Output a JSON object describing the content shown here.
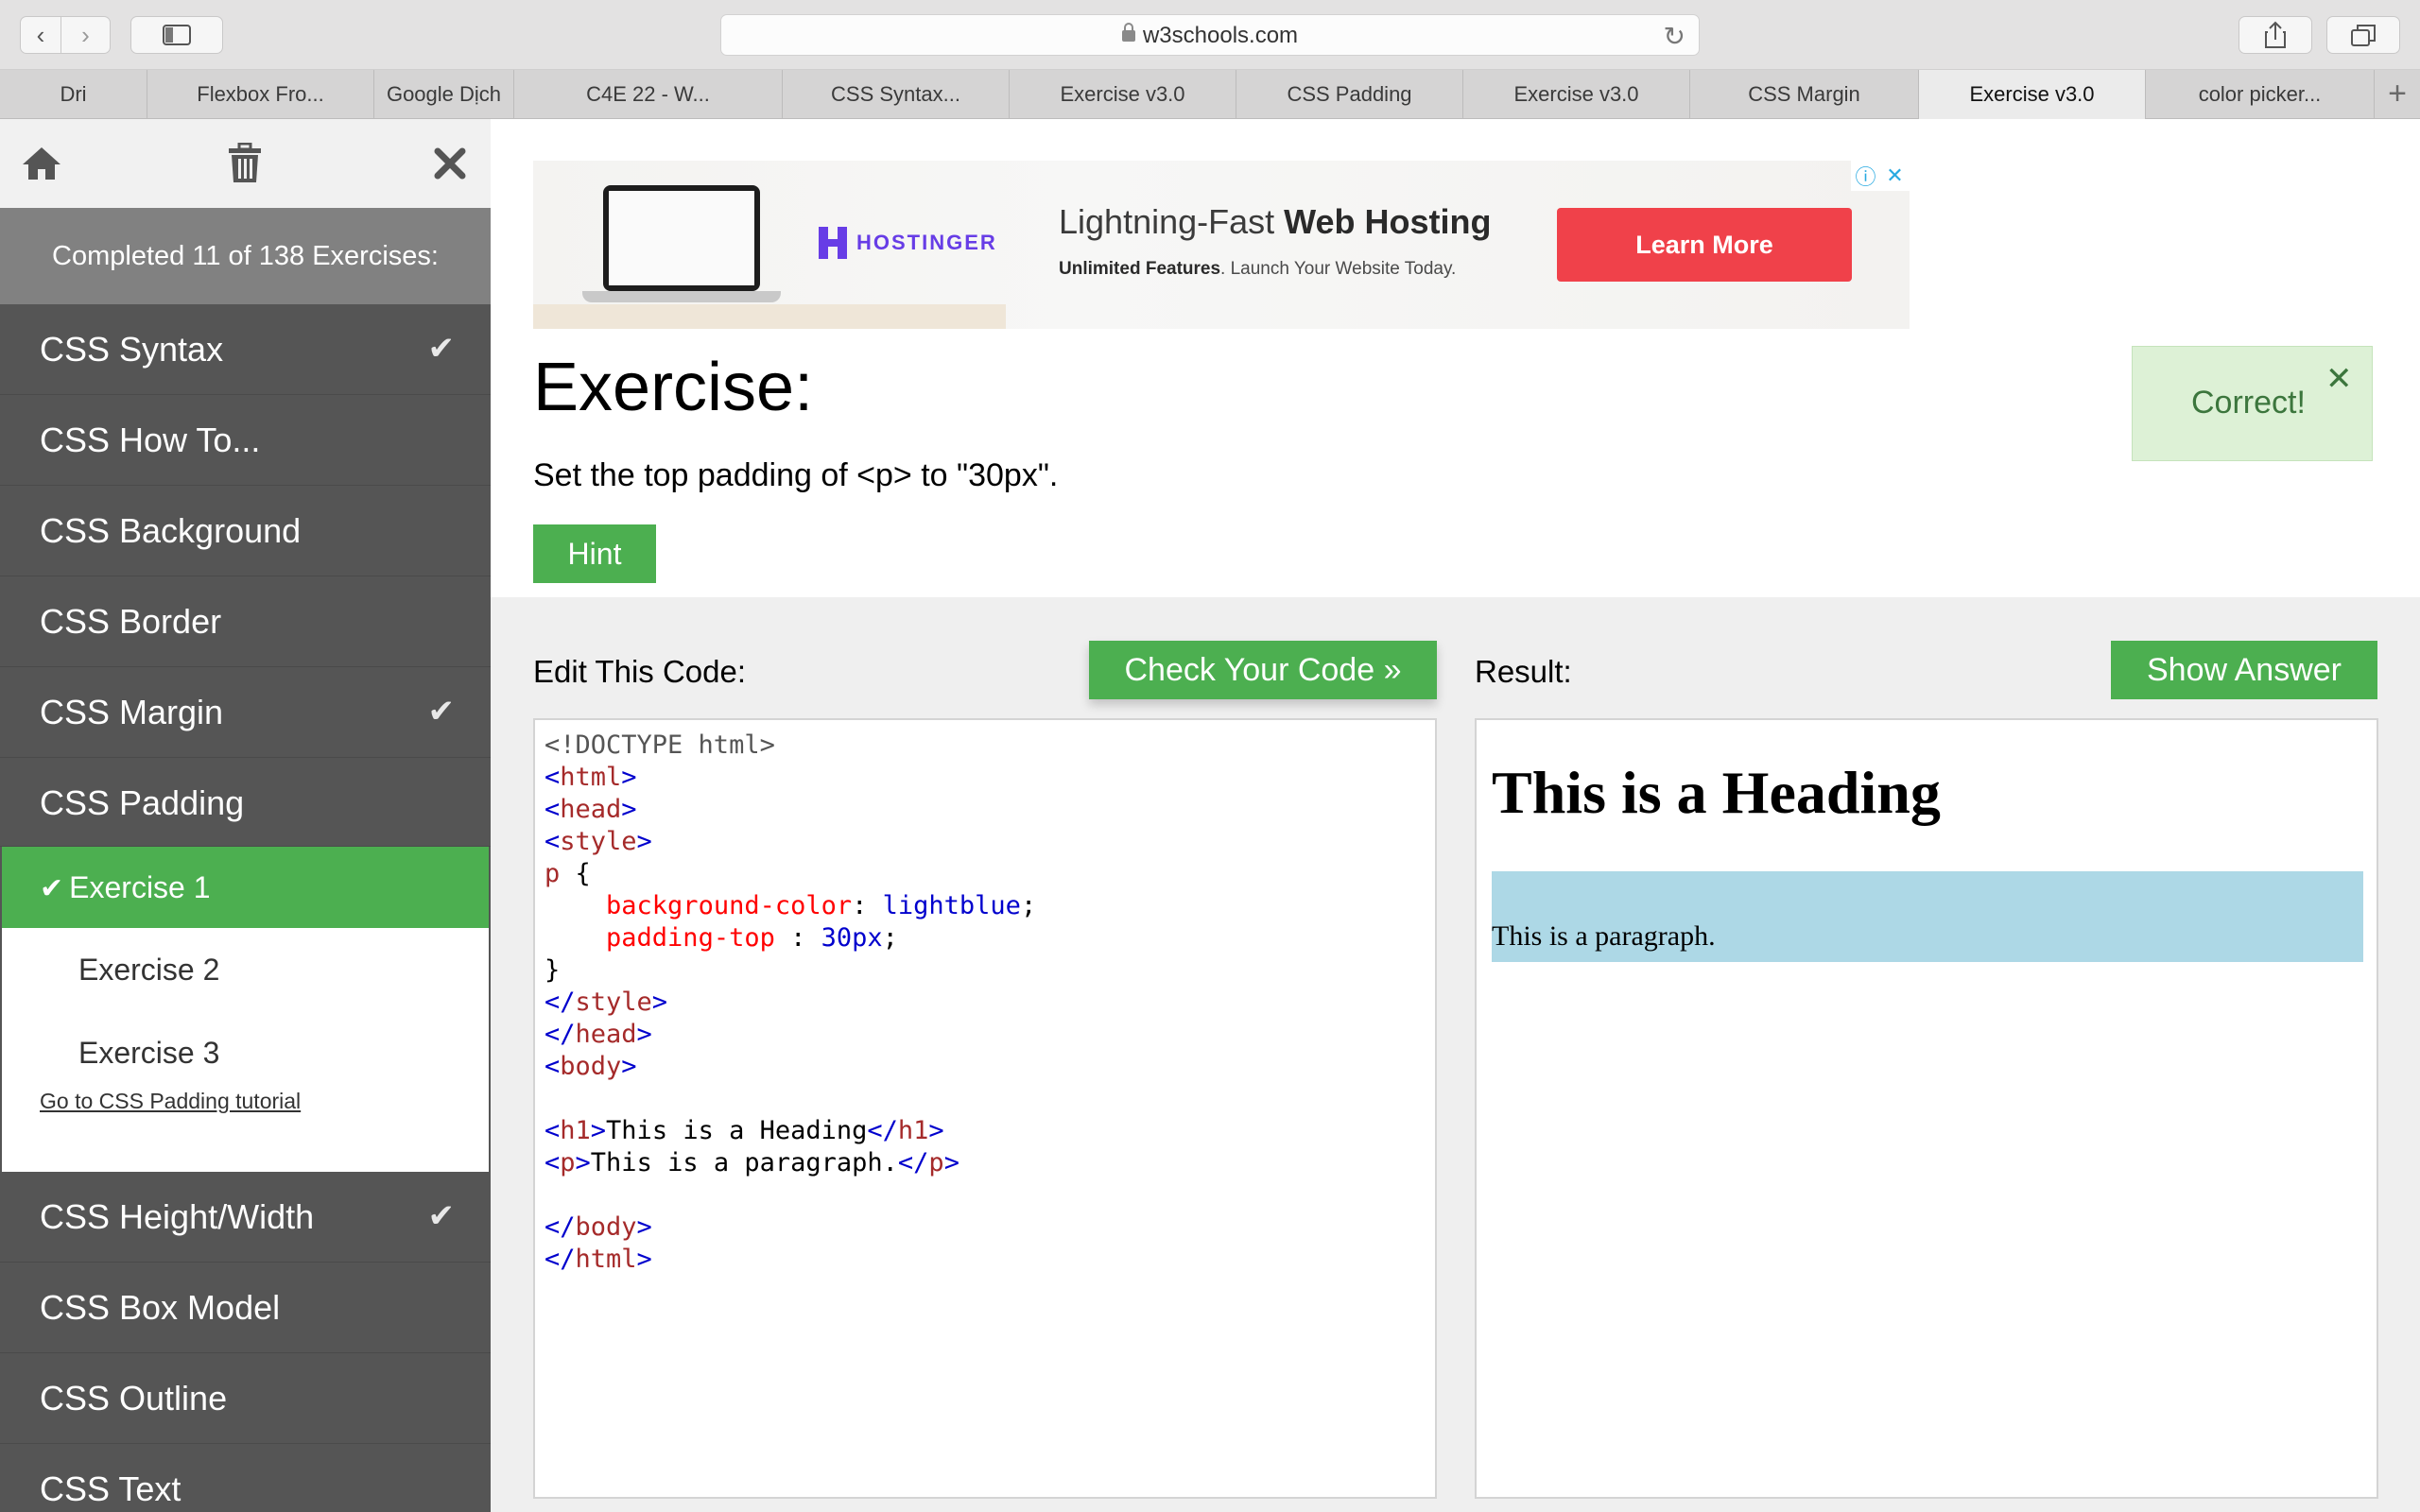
{
  "browser": {
    "url": "w3schools.com",
    "tabs": [
      "Dri",
      "Flexbox Fro...",
      "Google Dịch",
      "C4E 22 - W...",
      "CSS Syntax...",
      "Exercise v3.0",
      "CSS Padding",
      "Exercise v3.0",
      "CSS Margin",
      "Exercise v3.0",
      "color picker..."
    ],
    "active_tab_index": 9
  },
  "sidebar": {
    "completed_text": "Completed 11 of 138 Exercises:",
    "topics": [
      {
        "label": "CSS Syntax",
        "completed": true
      },
      {
        "label": "CSS How To...",
        "completed": false
      },
      {
        "label": "CSS Background",
        "completed": false
      },
      {
        "label": "CSS Border",
        "completed": false
      },
      {
        "label": "CSS Margin",
        "completed": true
      },
      {
        "label": "CSS Padding",
        "completed": false
      },
      {
        "label": "CSS Height/Width",
        "completed": true
      },
      {
        "label": "CSS Box Model",
        "completed": false
      },
      {
        "label": "CSS Outline",
        "completed": false
      },
      {
        "label": "CSS Text",
        "completed": false
      }
    ],
    "exercises": [
      {
        "label": "Exercise 1",
        "active": true,
        "completed": true
      },
      {
        "label": "Exercise 2",
        "active": false,
        "completed": false
      },
      {
        "label": "Exercise 3",
        "active": false,
        "completed": false
      }
    ],
    "tutorial_link": "Go to CSS Padding tutorial"
  },
  "ad": {
    "brand": "HOSTINGER",
    "headline_regular": "Lightning-Fast ",
    "headline_bold": "Web Hosting",
    "sub_bold": "Unlimited Features",
    "sub_regular": ". Launch Your Website Today.",
    "cta": "Learn More"
  },
  "exercise": {
    "title": "Exercise:",
    "description": "Set the top padding of <p> to \"30px\".",
    "hint_label": "Hint",
    "toast": "Correct!"
  },
  "editor": {
    "label": "Edit This Code:",
    "check_label": "Check Your Code »",
    "code": {
      "doctype": "<!DOCTYPE html>",
      "selector": "p",
      "prop1": "background-color",
      "val1": "lightblue",
      "prop2": "padding-top",
      "val2": "30px",
      "h1_text": "This is a Heading",
      "p_text": "This is a paragraph."
    }
  },
  "result": {
    "label": "Result:",
    "answer_label": "Show Answer",
    "heading": "This is a Heading",
    "paragraph": "This is a paragraph.",
    "paragraph_bg": "#add8e6"
  },
  "colors": {
    "accent_green": "#4caf50",
    "sidebar_bg": "#555555",
    "ad_cta": "#f0414a"
  }
}
